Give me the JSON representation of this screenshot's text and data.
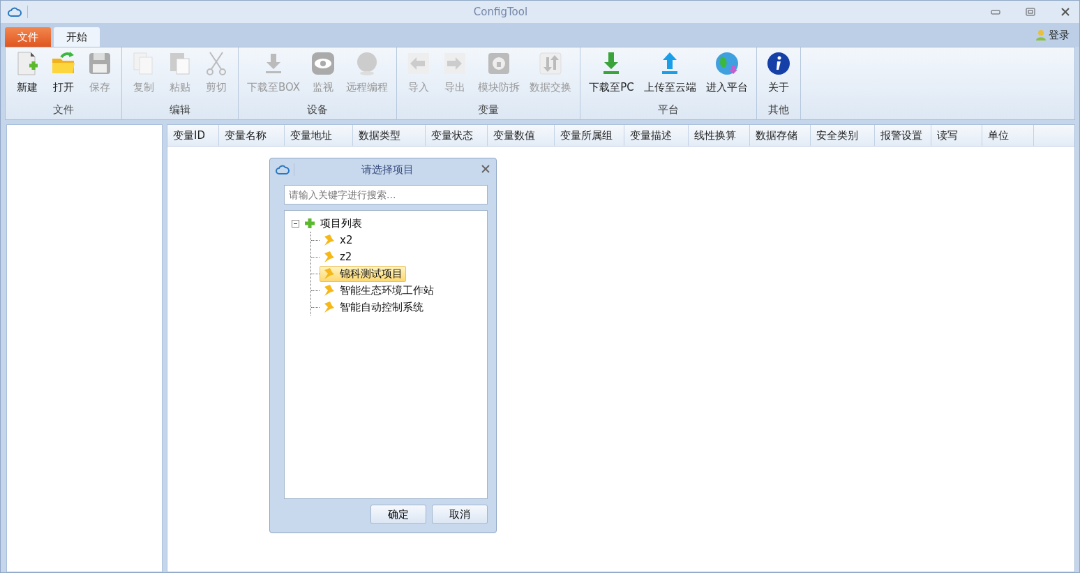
{
  "window": {
    "title": "ConfigTool"
  },
  "tabs": [
    {
      "label": "文件",
      "kind": "file",
      "selected": false
    },
    {
      "label": "开始",
      "kind": "tab",
      "selected": true
    }
  ],
  "login": {
    "label": "登录"
  },
  "ribbon": [
    {
      "label": "文件",
      "buttons": [
        {
          "label": "新建",
          "disabled": false
        },
        {
          "label": "打开",
          "disabled": false
        },
        {
          "label": "保存",
          "disabled": true
        }
      ]
    },
    {
      "label": "编辑",
      "buttons": [
        {
          "label": "复制",
          "disabled": true
        },
        {
          "label": "粘贴",
          "disabled": true
        },
        {
          "label": "剪切",
          "disabled": true
        }
      ]
    },
    {
      "label": "设备",
      "buttons": [
        {
          "label": "下载至BOX",
          "disabled": true
        },
        {
          "label": "监视",
          "disabled": true
        },
        {
          "label": "远程编程",
          "disabled": true
        }
      ]
    },
    {
      "label": "变量",
      "buttons": [
        {
          "label": "导入",
          "disabled": true
        },
        {
          "label": "导出",
          "disabled": true
        },
        {
          "label": "模块防拆",
          "disabled": true
        },
        {
          "label": "数据交换",
          "disabled": true
        }
      ]
    },
    {
      "label": "平台",
      "buttons": [
        {
          "label": "下载至PC",
          "disabled": false
        },
        {
          "label": "上传至云端",
          "disabled": false
        },
        {
          "label": "进入平台",
          "disabled": false
        }
      ]
    },
    {
      "label": "其他",
      "buttons": [
        {
          "label": "关于",
          "disabled": false
        }
      ]
    }
  ],
  "table": {
    "columns": [
      "变量ID",
      "变量名称",
      "变量地址",
      "数据类型",
      "变量状态",
      "变量数值",
      "变量所属组",
      "变量描述",
      "线性换算",
      "数据存储",
      "安全类别",
      "报警设置",
      "读写",
      "单位"
    ]
  },
  "dialog": {
    "title": "请选择项目",
    "search": {
      "placeholder": "请输入关键字进行搜索..."
    },
    "tree": {
      "label": "项目列表",
      "expanded": true,
      "children": [
        {
          "label": "x2",
          "selected": false
        },
        {
          "label": "z2",
          "selected": false
        },
        {
          "label": "锦科测试项目",
          "selected": true
        },
        {
          "label": "智能生态环境工作站",
          "selected": false
        },
        {
          "label": "智能自动控制系统",
          "selected": false
        }
      ]
    },
    "buttons": [
      "确定",
      "取消"
    ]
  }
}
